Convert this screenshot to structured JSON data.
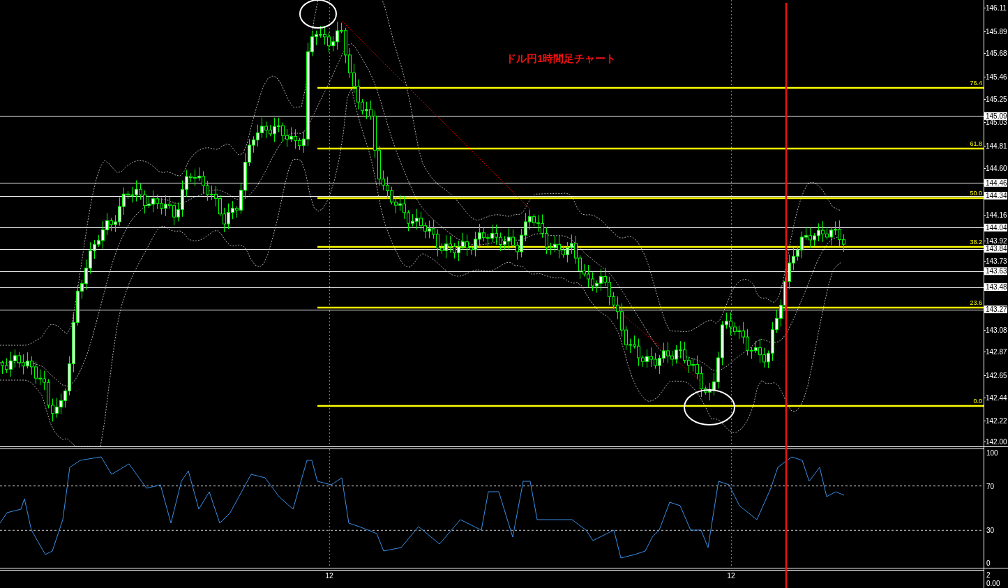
{
  "chart": {
    "title": "ドル円1時間足チャート",
    "price_axis": [
      {
        "label": "146.11",
        "kind": "tick"
      },
      {
        "label": "145.89",
        "kind": "tick"
      },
      {
        "label": "145.68",
        "kind": "tick"
      },
      {
        "label": "145.46",
        "kind": "tick"
      },
      {
        "label": "145.25",
        "kind": "tick"
      },
      {
        "label": "145.09",
        "kind": "line"
      },
      {
        "label": "145.03",
        "kind": "tick"
      },
      {
        "label": "144.81",
        "kind": "tick"
      },
      {
        "label": "144.60",
        "kind": "tick"
      },
      {
        "label": "144.46",
        "kind": "line"
      },
      {
        "label": "144.34",
        "kind": "line"
      },
      {
        "label": "144.16",
        "kind": "tick"
      },
      {
        "label": "144.04",
        "kind": "line"
      },
      {
        "label": "143.92",
        "kind": "tick"
      },
      {
        "label": "143.84",
        "kind": "line"
      },
      {
        "label": "143.73",
        "kind": "tick"
      },
      {
        "label": "143.63",
        "kind": "line"
      },
      {
        "label": "143.48",
        "kind": "line"
      },
      {
        "label": "143.27",
        "kind": "line"
      },
      {
        "label": "143.08",
        "kind": "tick"
      },
      {
        "label": "142.87",
        "kind": "tick"
      },
      {
        "label": "142.65",
        "kind": "tick"
      },
      {
        "label": "142.44",
        "kind": "tick"
      },
      {
        "label": "142.22",
        "kind": "tick"
      },
      {
        "label": "142.00",
        "kind": "tick"
      }
    ],
    "fibonacci_levels": [
      "76.4",
      "61.8",
      "50.0",
      "38.2",
      "23.6",
      "0.0"
    ],
    "rsi_axis": [
      "100",
      "70",
      "30",
      "0"
    ],
    "lower_axis": [
      "2",
      "0.00"
    ],
    "time_labels": [
      "12",
      "12"
    ]
  }
}
